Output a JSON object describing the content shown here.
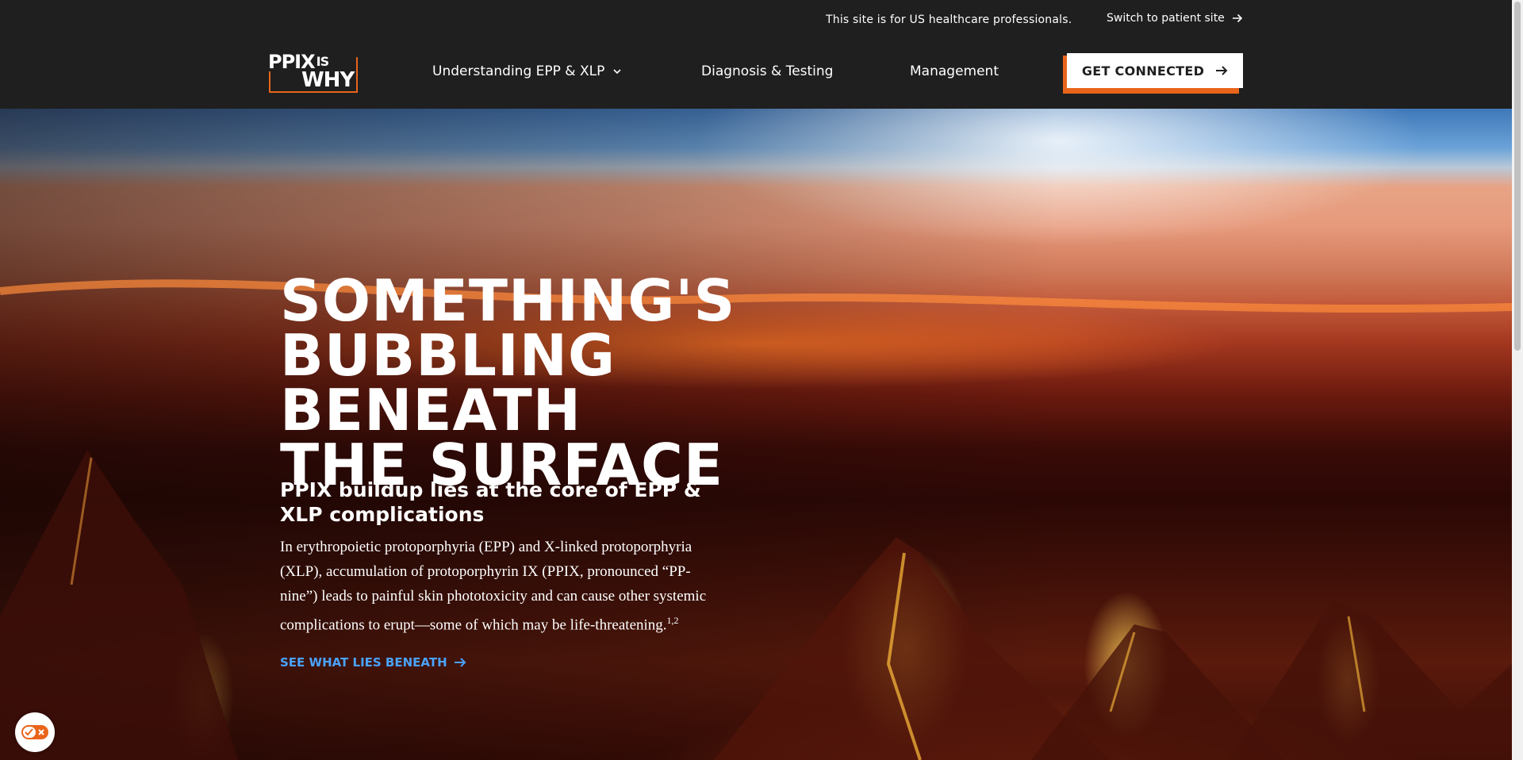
{
  "utility_bar": {
    "notice": "This site is for US healthcare professionals.",
    "switch_label": "Switch to patient site"
  },
  "logo": {
    "line1": "PPIX",
    "line1_small": "IS",
    "line2": "WHY"
  },
  "nav": {
    "items": [
      {
        "label": "Understanding EPP & XLP",
        "icon": "chevron-down-icon"
      },
      {
        "label": "Diagnosis & Testing"
      },
      {
        "label": "Management"
      }
    ],
    "cta_label": "GET CONNECTED"
  },
  "hero": {
    "headline_lines": [
      "SOMETHING'S",
      "BUBBLING BENEATH",
      "THE SURFACE"
    ],
    "subhead": "PPIX buildup lies at the core of EPP & XLP complications",
    "body": "In erythropoietic protoporphyria (EPP) and X-linked protoporphyria (XLP), accumulation of protoporphyrin IX (PPIX, pronounced “PP-nine”) leads to painful skin phototoxicity and can cause other systemic complications to erupt—some of which may be life-threatening.",
    "body_sup": "1,2",
    "link_label": "SEE WHAT LIES BENEATH"
  },
  "colors": {
    "header_bg": "#1f1f1f",
    "accent_orange": "#e9641b",
    "link_blue": "#4aa3ff"
  }
}
